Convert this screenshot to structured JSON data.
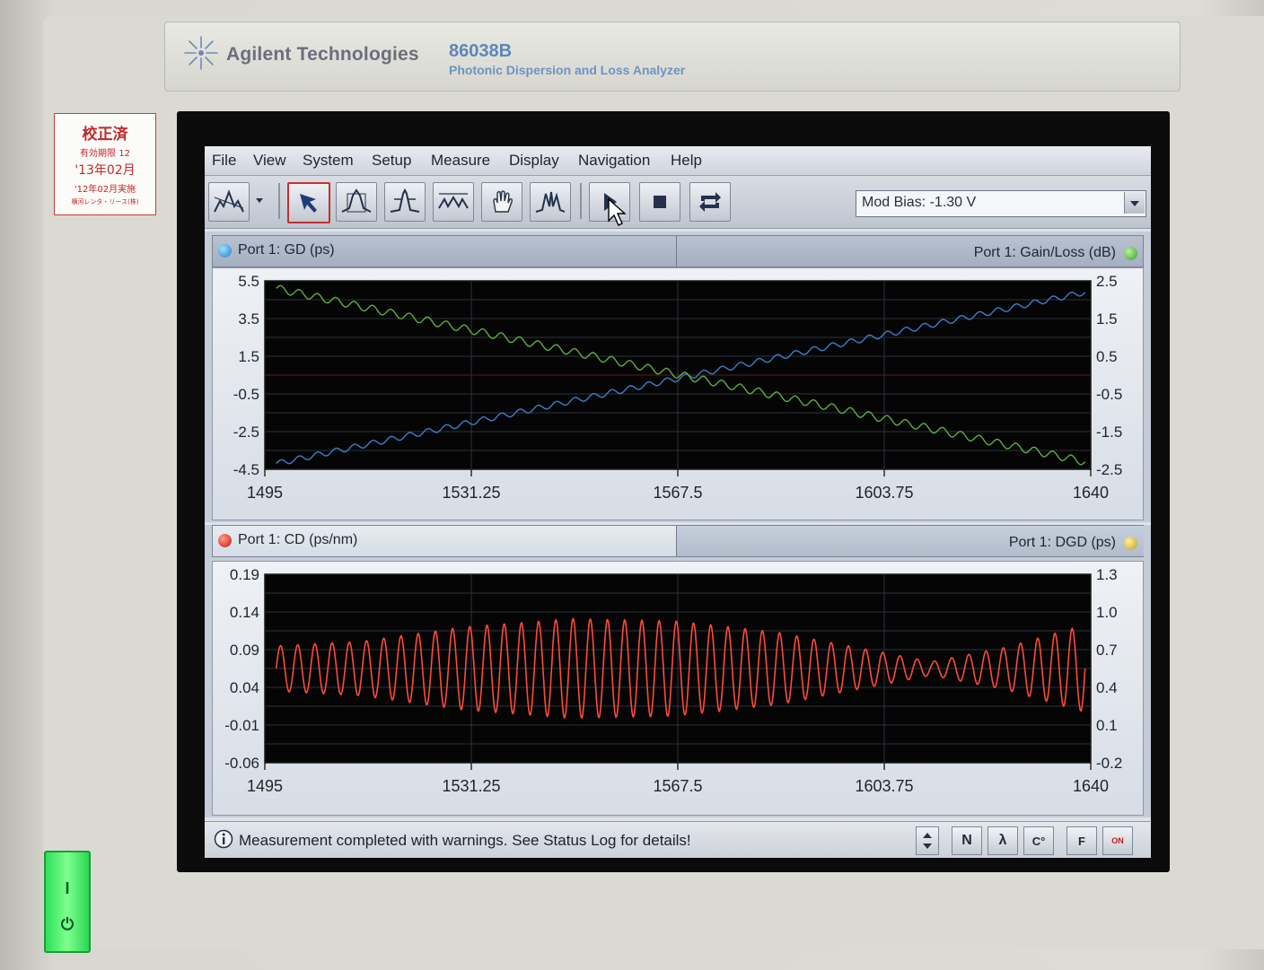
{
  "device": {
    "brand": "Agilent Technologies",
    "model": "86038B",
    "model_description": "Photonic Dispersion and Loss Analyzer",
    "calibration_sticker": [
      "校正済",
      "有効期限 12",
      "'13年02月",
      "'12年02月実施",
      "横河レンタ・リース(株)"
    ],
    "power_on_symbol": "I",
    "power_off_symbol": "⏻"
  },
  "menu": [
    "File",
    "View",
    "System",
    "Setup",
    "Measure",
    "Display",
    "Navigation",
    "Help"
  ],
  "toolbar": {
    "mod_bias_value": "Mod Bias: -1.30 V"
  },
  "top_panel": {
    "left_title": "Port 1: GD (ps)",
    "right_title": "Port 1: Gain/Loss (dB)"
  },
  "bottom_panel": {
    "left_title": "Port 1: CD (ps/nm)",
    "right_title": "Port 1: DGD (ps)"
  },
  "status": {
    "message": "Measurement completed with warnings. See Status Log for details!",
    "buttons": [
      "N",
      "λ",
      "C°",
      "F",
      "ON"
    ]
  },
  "colors": {
    "gd_trace": "#3a7fc8",
    "gain_trace": "#5fae3a",
    "cd_trace": "#ff4a3a",
    "plot_bg": "#050505",
    "grid": "#2a3340"
  },
  "chart_data": [
    {
      "type": "line",
      "x": [
        1495,
        1640
      ],
      "xticks": [
        "1495",
        "1531.25",
        "1567.5",
        "1603.75",
        "1640"
      ],
      "xlim": [
        1495,
        1640
      ],
      "ylim": [
        -4.5,
        5.5
      ],
      "yticks_left": [
        "5.5",
        "3.5",
        "1.5",
        "-0.5",
        "-2.5",
        "-4.5"
      ],
      "ylim_right": [
        -2.5,
        2.5
      ],
      "yticks_right": [
        "2.5",
        "1.5",
        "0.5",
        "-0.5",
        "-1.5",
        "-2.5"
      ],
      "series": [
        {
          "name": "Port 1: GD (ps)",
          "axis": "left",
          "x": [
            1497,
            1639
          ],
          "y": [
            -4.2,
            4.9
          ],
          "ripple": 0.15
        },
        {
          "name": "Port 1: Gain/Loss (dB)",
          "axis": "right",
          "x": [
            1497,
            1639
          ],
          "y": [
            2.3,
            -2.3
          ],
          "ripple": 0.1
        }
      ]
    },
    {
      "type": "line",
      "x": [
        1495,
        1640
      ],
      "xticks": [
        "1495",
        "1531.25",
        "1567.5",
        "1603.75",
        "1640"
      ],
      "xlim": [
        1495,
        1640
      ],
      "ylim": [
        -0.06,
        0.19
      ],
      "yticks_left": [
        "0.19",
        "0.14",
        "0.09",
        "0.04",
        "-0.01",
        "-0.06"
      ],
      "ylim_right": [
        -0.2,
        1.3
      ],
      "yticks_right": [
        "1.3",
        "1.0",
        "0.7",
        "0.4",
        "0.1",
        "-0.2"
      ],
      "series": [
        {
          "name": "Port 1: CD (ps/nm)",
          "axis": "left",
          "center": 0.065,
          "periods": 47,
          "x": [
            1497,
            1512,
            1530,
            1549,
            1567,
            1585,
            1603,
            1612,
            1625,
            1639
          ],
          "amplitude": [
            0.03,
            0.036,
            0.055,
            0.066,
            0.063,
            0.048,
            0.022,
            0.009,
            0.028,
            0.058
          ]
        }
      ]
    }
  ]
}
